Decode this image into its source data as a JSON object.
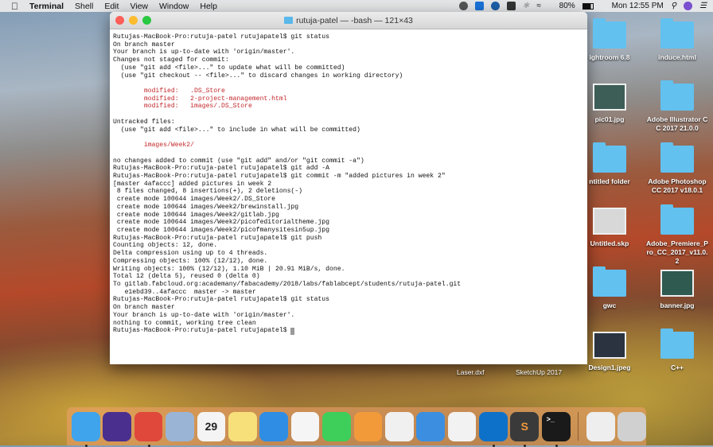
{
  "menubar": {
    "apple": "",
    "app": "Terminal",
    "items": [
      "Shell",
      "Edit",
      "View",
      "Window",
      "Help"
    ],
    "battery": "80%",
    "clock": "Mon 12:55 PM"
  },
  "window": {
    "title": "rutuja-patel — -bash — 121×43"
  },
  "terminal": {
    "lines": [
      {
        "t": "Rutujas-MacBook-Pro:rutuja-patel rutujapatel$ git status"
      },
      {
        "t": "On branch master"
      },
      {
        "t": "Your branch is up-to-date with 'origin/master'."
      },
      {
        "t": "Changes not staged for commit:"
      },
      {
        "t": "  (use \"git add <file>...\" to update what will be committed)"
      },
      {
        "t": "  (use \"git checkout -- <file>...\" to discard changes in working directory)"
      },
      {
        "t": ""
      },
      {
        "t": "        modified:   .DS_Store",
        "red": true
      },
      {
        "t": "        modified:   2-project-management.html",
        "red": true
      },
      {
        "t": "        modified:   images/.DS_Store",
        "red": true
      },
      {
        "t": ""
      },
      {
        "t": "Untracked files:"
      },
      {
        "t": "  (use \"git add <file>...\" to include in what will be committed)"
      },
      {
        "t": ""
      },
      {
        "t": "        images/Week2/",
        "red": true
      },
      {
        "t": ""
      },
      {
        "t": "no changes added to commit (use \"git add\" and/or \"git commit -a\")"
      },
      {
        "t": "Rutujas-MacBook-Pro:rutuja-patel rutujapatel$ git add -A"
      },
      {
        "t": "Rutujas-MacBook-Pro:rutuja-patel rutujapatel$ git commit -m \"added pictures in week 2\""
      },
      {
        "t": "[master 4afaccc] added pictures in week 2"
      },
      {
        "t": " 8 files changed, 8 insertions(+), 2 deletions(-)"
      },
      {
        "t": " create mode 100644 images/Week2/.DS_Store"
      },
      {
        "t": " create mode 100644 images/Week2/brewinstall.jpg"
      },
      {
        "t": " create mode 100644 images/Week2/gitlab.jpg"
      },
      {
        "t": " create mode 100644 images/Week2/picofeditorialtheme.jpg"
      },
      {
        "t": " create mode 100644 images/Week2/picofmanysitesin5up.jpg"
      },
      {
        "t": "Rutujas-MacBook-Pro:rutuja-patel rutujapatel$ git push"
      },
      {
        "t": "Counting objects: 12, done."
      },
      {
        "t": "Delta compression using up to 4 threads."
      },
      {
        "t": "Compressing objects: 100% (12/12), done."
      },
      {
        "t": "Writing objects: 100% (12/12), 1.10 MiB | 20.91 MiB/s, done."
      },
      {
        "t": "Total 12 (delta 5), reused 0 (delta 0)"
      },
      {
        "t": "To gitlab.fabcloud.org:academany/fabacademy/2018/labs/fablabcept/students/rutuja-patel.git"
      },
      {
        "t": "   e1ebd39..4afaccc  master -> master"
      },
      {
        "t": "Rutujas-MacBook-Pro:rutuja-patel rutujapatel$ git status"
      },
      {
        "t": "On branch master"
      },
      {
        "t": "Your branch is up-to-date with 'origin/master'."
      },
      {
        "t": "nothing to commit, working tree clean"
      }
    ],
    "prompt": "Rutujas-MacBook-Pro:rutuja-patel rutujapatel$ "
  },
  "desktop": {
    "icons": [
      {
        "label": "ightroom 6.8",
        "kind": "folder"
      },
      {
        "label": "induce.html",
        "kind": "folder"
      },
      {
        "label": "pic01.jpg",
        "kind": "thumb",
        "color": "#3d5e57"
      },
      {
        "label": "Adobe Illustrator CC 2017 21.0.0",
        "kind": "folder"
      },
      {
        "label": "ntitled folder",
        "kind": "folder"
      },
      {
        "label": "Adobe Photoshop CC 2017 v18.0.1",
        "kind": "folder"
      },
      {
        "label": "Untitled.skp",
        "kind": "thumb",
        "color": "#d8d8d8"
      },
      {
        "label": "Adobe_Premiere_Pro_CC_2017_v11.0.2",
        "kind": "folder"
      },
      {
        "label": "gwc",
        "kind": "folder"
      },
      {
        "label": "banner.jpg",
        "kind": "thumb",
        "color": "#2e5a50"
      },
      {
        "label": "Design1.jpeg",
        "kind": "thumb",
        "color": "#2b3340"
      },
      {
        "label": "C++",
        "kind": "folder"
      }
    ],
    "bottom_labels": [
      "Laser.dxf",
      "SketchUp 2017"
    ]
  },
  "dock": {
    "apps": [
      {
        "name": "finder",
        "color": "#3fa4ec",
        "running": true
      },
      {
        "name": "siri",
        "color": "#4a2f8f"
      },
      {
        "name": "chrome",
        "color": "#e0483c",
        "running": true
      },
      {
        "name": "mail",
        "color": "#9ab4d6"
      },
      {
        "name": "calendar",
        "color": "#f4f4f4",
        "glyph": "29"
      },
      {
        "name": "notes",
        "color": "#f7e07a"
      },
      {
        "name": "safari",
        "color": "#2f8de4"
      },
      {
        "name": "photos",
        "color": "#f5f5f5"
      },
      {
        "name": "facetime",
        "color": "#3ecf5a"
      },
      {
        "name": "pages",
        "color": "#f29a3a"
      },
      {
        "name": "numbers",
        "color": "#f0f0f0"
      },
      {
        "name": "keynote",
        "color": "#3c8fe0"
      },
      {
        "name": "itunes",
        "color": "#f2f2f2"
      },
      {
        "name": "teamviewer",
        "color": "#0e71c9",
        "running": true
      },
      {
        "name": "sublime-text",
        "color": "#3a3a3a",
        "glyph": "S",
        "running": true
      },
      {
        "name": "terminal",
        "color": "#1a1a1a",
        "glyph": ">_",
        "running": true
      }
    ],
    "extra": [
      {
        "name": "document",
        "color": "#eeeeee"
      },
      {
        "name": "trash",
        "color": "#d0d0d0"
      }
    ]
  }
}
